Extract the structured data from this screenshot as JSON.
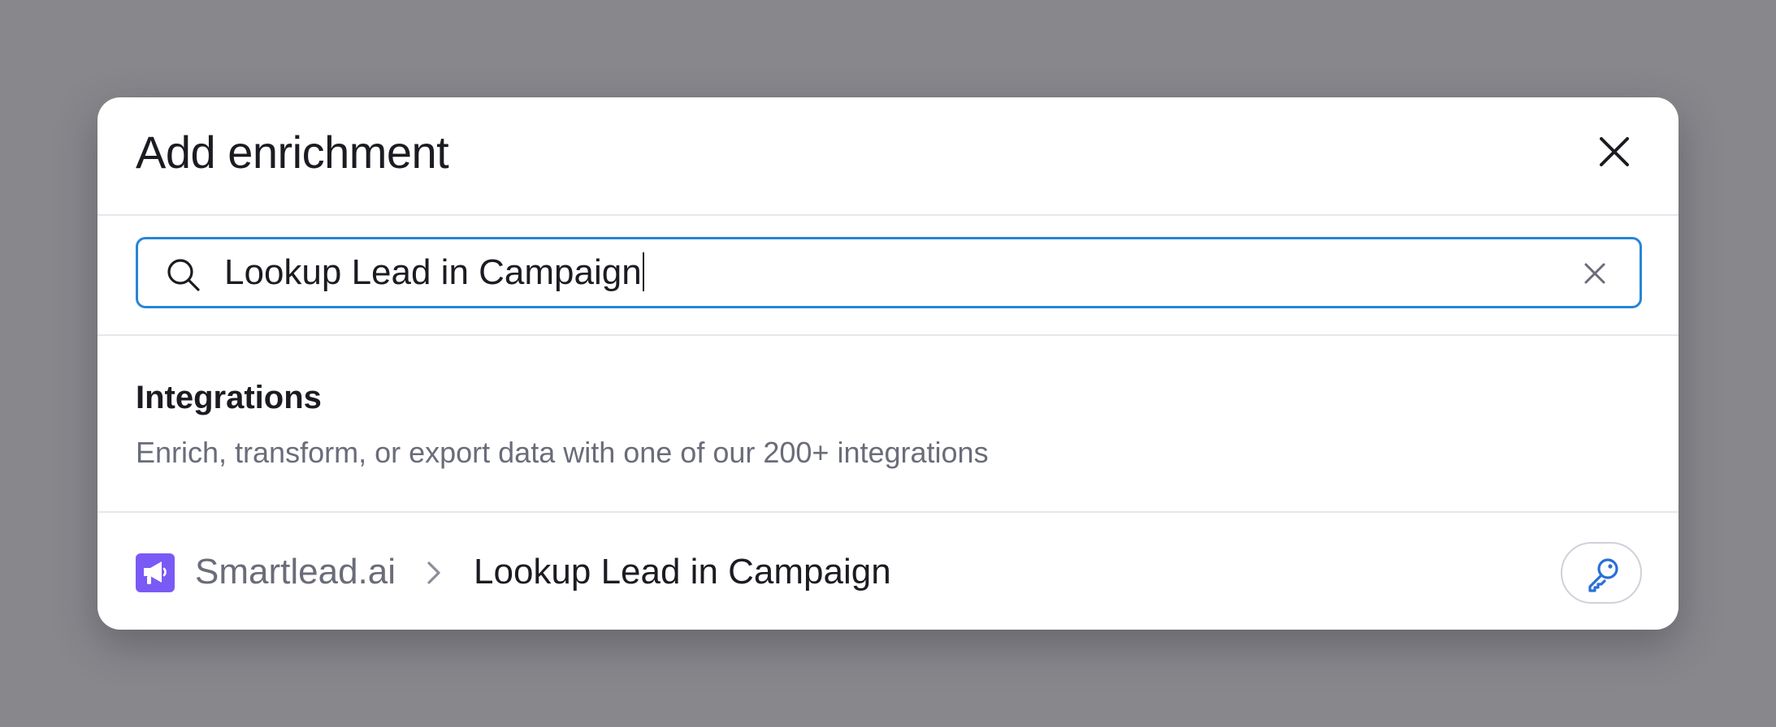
{
  "modal": {
    "title": "Add enrichment",
    "close_icon": "close-icon"
  },
  "search": {
    "value": "Lookup Lead in Campaign",
    "icon": "search-icon",
    "clear_icon": "clear-icon"
  },
  "integrations": {
    "title": "Integrations",
    "subtitle": "Enrich, transform, or export data with one of our 200+ integrations"
  },
  "result": {
    "app_name": "Smartlead.ai",
    "action_name": "Lookup Lead in Campaign",
    "app_icon": "megaphone-icon",
    "separator_icon": "chevron-right-icon",
    "auth_icon": "key-icon",
    "app_color": "#7a5af5"
  },
  "colors": {
    "backdrop": "#88878c",
    "accent": "#2785d6",
    "text_primary": "#1b1c22",
    "text_secondary": "#6a6c7a"
  }
}
